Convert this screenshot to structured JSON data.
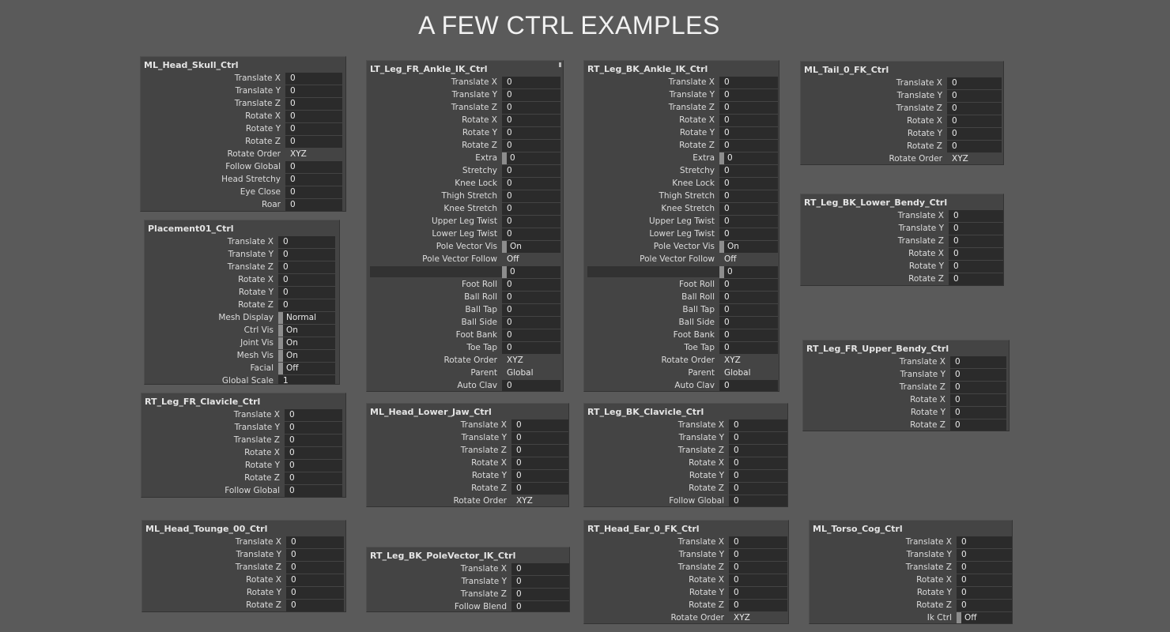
{
  "title": "A FEW CTRL EXAMPLES",
  "panels": [
    {
      "id": "p0",
      "title": "ML_Head_Skull_Ctrl",
      "rows": [
        {
          "label": "Translate X",
          "value": "0"
        },
        {
          "label": "Translate Y",
          "value": "0"
        },
        {
          "label": "Translate Z",
          "value": "0"
        },
        {
          "label": "Rotate X",
          "value": "0"
        },
        {
          "label": "Rotate Y",
          "value": "0"
        },
        {
          "label": "Rotate Z",
          "value": "0"
        },
        {
          "label": "Rotate Order",
          "value": "XYZ",
          "kind": "plain"
        },
        {
          "label": "Follow Global",
          "value": "0"
        },
        {
          "label": "Head Stretchy",
          "value": "0"
        },
        {
          "label": "Eye Close",
          "value": "0"
        },
        {
          "label": "Roar",
          "value": "0"
        }
      ]
    },
    {
      "id": "p1",
      "title": "Placement01_Ctrl",
      "rows": [
        {
          "label": "Translate X",
          "value": "0"
        },
        {
          "label": "Translate Y",
          "value": "0"
        },
        {
          "label": "Translate Z",
          "value": "0"
        },
        {
          "label": "Rotate X",
          "value": "0"
        },
        {
          "label": "Rotate Y",
          "value": "0"
        },
        {
          "label": "Rotate Z",
          "value": "0"
        },
        {
          "label": "Mesh Display",
          "value": "Normal",
          "kind": "mark"
        },
        {
          "label": "Ctrl Vis",
          "value": "On",
          "kind": "mark"
        },
        {
          "label": "Joint Vis",
          "value": "On",
          "kind": "mark"
        },
        {
          "label": "Mesh Vis",
          "value": "On",
          "kind": "mark"
        },
        {
          "label": "Facial",
          "value": "Off",
          "kind": "mark"
        },
        {
          "label": "Global Scale",
          "value": "1"
        }
      ]
    },
    {
      "id": "p2",
      "title": "RT_Leg_FR_Clavicle_Ctrl",
      "rows": [
        {
          "label": "Translate X",
          "value": "0"
        },
        {
          "label": "Translate Y",
          "value": "0"
        },
        {
          "label": "Translate Z",
          "value": "0"
        },
        {
          "label": "Rotate X",
          "value": "0"
        },
        {
          "label": "Rotate Y",
          "value": "0"
        },
        {
          "label": "Rotate Z",
          "value": "0"
        },
        {
          "label": "Follow Global",
          "value": "0"
        }
      ]
    },
    {
      "id": "p3",
      "title": "ML_Head_Tounge_00_Ctrl",
      "rows": [
        {
          "label": "Translate X",
          "value": "0"
        },
        {
          "label": "Translate Y",
          "value": "0"
        },
        {
          "label": "Translate Z",
          "value": "0"
        },
        {
          "label": "Rotate X",
          "value": "0"
        },
        {
          "label": "Rotate Y",
          "value": "0"
        },
        {
          "label": "Rotate Z",
          "value": "0"
        }
      ]
    },
    {
      "id": "p4",
      "title": "LT_Leg_FR_Ankle_IK_Ctrl",
      "rows": [
        {
          "label": "Translate X",
          "value": "0"
        },
        {
          "label": "Translate Y",
          "value": "0"
        },
        {
          "label": "Translate Z",
          "value": "0"
        },
        {
          "label": "Rotate X",
          "value": "0"
        },
        {
          "label": "Rotate Y",
          "value": "0"
        },
        {
          "label": "Rotate Z",
          "value": "0"
        },
        {
          "label": "Extra",
          "value": "0",
          "kind": "mark"
        },
        {
          "label": "Stretchy",
          "value": "0"
        },
        {
          "label": "Knee Lock",
          "value": "0"
        },
        {
          "label": "Thigh Stretch",
          "value": "0"
        },
        {
          "label": "Knee Stretch",
          "value": "0"
        },
        {
          "label": "Upper Leg Twist",
          "value": "0"
        },
        {
          "label": "Lower Leg Twist",
          "value": "0"
        },
        {
          "label": "Pole Vector Vis",
          "value": "On",
          "kind": "mark"
        },
        {
          "label": "Pole Vector Follow",
          "value": "Off",
          "kind": "plain"
        },
        {
          "label": "",
          "value": "0",
          "kind": "sep"
        },
        {
          "label": "Foot Roll",
          "value": "0"
        },
        {
          "label": "Ball Roll",
          "value": "0"
        },
        {
          "label": "Ball Tap",
          "value": "0"
        },
        {
          "label": "Ball Side",
          "value": "0"
        },
        {
          "label": "Foot Bank",
          "value": "0"
        },
        {
          "label": "Toe Tap",
          "value": "0"
        },
        {
          "label": "Rotate Order",
          "value": "XYZ",
          "kind": "plain"
        },
        {
          "label": "Parent",
          "value": "Global",
          "kind": "plain"
        },
        {
          "label": "Auto Clav",
          "value": "0"
        }
      ]
    },
    {
      "id": "p5",
      "title": "ML_Head_Lower_Jaw_Ctrl",
      "rows": [
        {
          "label": "Translate X",
          "value": "0"
        },
        {
          "label": "Translate Y",
          "value": "0"
        },
        {
          "label": "Translate Z",
          "value": "0"
        },
        {
          "label": "Rotate X",
          "value": "0"
        },
        {
          "label": "Rotate Y",
          "value": "0"
        },
        {
          "label": "Rotate Z",
          "value": "0"
        },
        {
          "label": "Rotate Order",
          "value": "XYZ",
          "kind": "plain"
        }
      ]
    },
    {
      "id": "p6",
      "title": "RT_Leg_BK_PoleVector_IK_Ctrl",
      "rows": [
        {
          "label": "Translate X",
          "value": "0"
        },
        {
          "label": "Translate Y",
          "value": "0"
        },
        {
          "label": "Translate Z",
          "value": "0"
        },
        {
          "label": "Follow Blend",
          "value": "0"
        }
      ]
    },
    {
      "id": "p7",
      "title": "RT_Leg_BK_Ankle_IK_Ctrl",
      "rows": [
        {
          "label": "Translate X",
          "value": "0"
        },
        {
          "label": "Translate Y",
          "value": "0"
        },
        {
          "label": "Translate Z",
          "value": "0"
        },
        {
          "label": "Rotate X",
          "value": "0"
        },
        {
          "label": "Rotate Y",
          "value": "0"
        },
        {
          "label": "Rotate Z",
          "value": "0"
        },
        {
          "label": "Extra",
          "value": "0",
          "kind": "mark"
        },
        {
          "label": "Stretchy",
          "value": "0"
        },
        {
          "label": "Knee Lock",
          "value": "0"
        },
        {
          "label": "Thigh Stretch",
          "value": "0"
        },
        {
          "label": "Knee Stretch",
          "value": "0"
        },
        {
          "label": "Upper Leg Twist",
          "value": "0"
        },
        {
          "label": "Lower Leg Twist",
          "value": "0"
        },
        {
          "label": "Pole Vector Vis",
          "value": "On",
          "kind": "mark"
        },
        {
          "label": "Pole Vector Follow",
          "value": "Off",
          "kind": "plain"
        },
        {
          "label": "",
          "value": "0",
          "kind": "sep"
        },
        {
          "label": "Foot Roll",
          "value": "0"
        },
        {
          "label": "Ball Roll",
          "value": "0"
        },
        {
          "label": "Ball Tap",
          "value": "0"
        },
        {
          "label": "Ball Side",
          "value": "0"
        },
        {
          "label": "Foot Bank",
          "value": "0"
        },
        {
          "label": "Toe Tap",
          "value": "0"
        },
        {
          "label": "Rotate Order",
          "value": "XYZ",
          "kind": "plain"
        },
        {
          "label": "Parent",
          "value": "Global",
          "kind": "plain"
        },
        {
          "label": "Auto Clav",
          "value": "0"
        }
      ]
    },
    {
      "id": "p8",
      "title": "RT_Leg_BK_Clavicle_Ctrl",
      "rows": [
        {
          "label": "Translate X",
          "value": "0"
        },
        {
          "label": "Translate Y",
          "value": "0"
        },
        {
          "label": "Translate Z",
          "value": "0"
        },
        {
          "label": "Rotate X",
          "value": "0"
        },
        {
          "label": "Rotate Y",
          "value": "0"
        },
        {
          "label": "Rotate Z",
          "value": "0"
        },
        {
          "label": "Follow Global",
          "value": "0"
        }
      ]
    },
    {
      "id": "p9",
      "title": "RT_Head_Ear_0_FK_Ctrl",
      "rows": [
        {
          "label": "Translate X",
          "value": "0"
        },
        {
          "label": "Translate Y",
          "value": "0"
        },
        {
          "label": "Translate Z",
          "value": "0"
        },
        {
          "label": "Rotate X",
          "value": "0"
        },
        {
          "label": "Rotate Y",
          "value": "0"
        },
        {
          "label": "Rotate Z",
          "value": "0"
        },
        {
          "label": "Rotate Order",
          "value": "XYZ",
          "kind": "plain"
        }
      ]
    },
    {
      "id": "p10",
      "title": "ML_Tail_0_FK_Ctrl",
      "rows": [
        {
          "label": "Translate X",
          "value": "0"
        },
        {
          "label": "Translate Y",
          "value": "0"
        },
        {
          "label": "Translate Z",
          "value": "0"
        },
        {
          "label": "Rotate X",
          "value": "0"
        },
        {
          "label": "Rotate Y",
          "value": "0"
        },
        {
          "label": "Rotate Z",
          "value": "0"
        },
        {
          "label": "Rotate Order",
          "value": "XYZ",
          "kind": "plain"
        }
      ]
    },
    {
      "id": "p11",
      "title": "RT_Leg_BK_Lower_Bendy_Ctrl",
      "rows": [
        {
          "label": "Translate X",
          "value": "0"
        },
        {
          "label": "Translate Y",
          "value": "0"
        },
        {
          "label": "Translate Z",
          "value": "0"
        },
        {
          "label": "Rotate X",
          "value": "0"
        },
        {
          "label": "Rotate Y",
          "value": "0"
        },
        {
          "label": "Rotate Z",
          "value": "0"
        }
      ]
    },
    {
      "id": "p12",
      "title": "RT_Leg_FR_Upper_Bendy_Ctrl",
      "rows": [
        {
          "label": "Translate X",
          "value": "0"
        },
        {
          "label": "Translate Y",
          "value": "0"
        },
        {
          "label": "Translate Z",
          "value": "0"
        },
        {
          "label": "Rotate X",
          "value": "0"
        },
        {
          "label": "Rotate Y",
          "value": "0"
        },
        {
          "label": "Rotate Z",
          "value": "0"
        }
      ]
    },
    {
      "id": "p13",
      "title": "ML_Torso_Cog_Ctrl",
      "rows": [
        {
          "label": "Translate X",
          "value": "0"
        },
        {
          "label": "Translate Y",
          "value": "0"
        },
        {
          "label": "Translate Z",
          "value": "0"
        },
        {
          "label": "Rotate X",
          "value": "0"
        },
        {
          "label": "Rotate Y",
          "value": "0"
        },
        {
          "label": "Rotate Z",
          "value": "0"
        },
        {
          "label": "Ik Ctrl",
          "value": "Off",
          "kind": "mark"
        }
      ]
    }
  ]
}
